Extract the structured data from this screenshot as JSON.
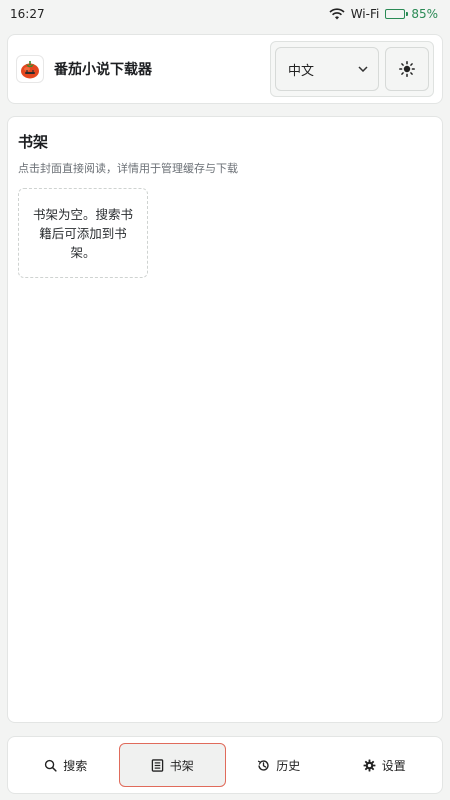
{
  "status_bar": {
    "time": "16:27",
    "wifi_label": "Wi-Fi",
    "battery_percent": "85%",
    "battery_level": 0.85,
    "icons": [
      "wifi-icon",
      "battery-icon"
    ]
  },
  "header": {
    "app_title": "番茄小说下载器",
    "logo_icon": "tomato-logo-icon",
    "language_select": {
      "selected": "中文",
      "icon": "chevron-down-icon"
    },
    "theme_toggle_icon": "sun-icon"
  },
  "shelf": {
    "title": "书架",
    "description": "点击封面直接阅读，详情用于管理缓存与下载",
    "empty_message": "书架为空。搜索书籍后可添加到书架。"
  },
  "bottom_nav": {
    "items": [
      {
        "label": "搜索",
        "icon": "search-icon",
        "active": false
      },
      {
        "label": "书架",
        "icon": "bookshelf-icon",
        "active": true
      },
      {
        "label": "历史",
        "icon": "history-icon",
        "active": false
      },
      {
        "label": "设置",
        "icon": "gear-icon",
        "active": false
      }
    ]
  },
  "colors": {
    "accent": "#e06b5b",
    "battery": "#2a8a55",
    "background": "#f3f4f3"
  }
}
